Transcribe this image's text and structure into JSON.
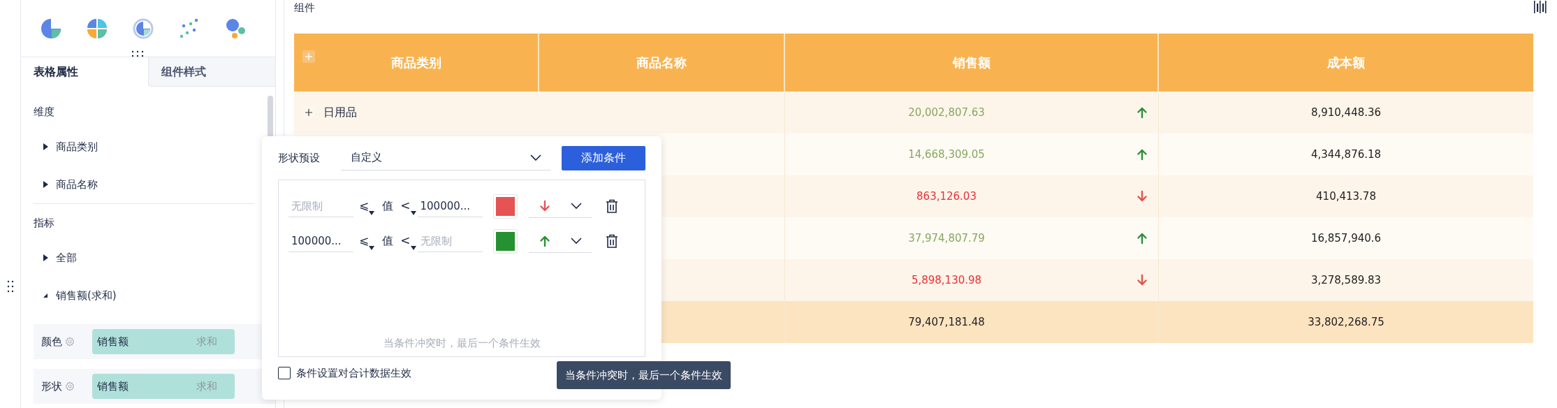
{
  "sidebar": {
    "tabs": [
      {
        "label": "表格属性",
        "selected": true
      },
      {
        "label": "组件样式",
        "selected": false
      }
    ],
    "sections": [
      {
        "title": "维度",
        "items": [
          {
            "label": "商品类别",
            "expanded": false
          },
          {
            "label": "商品名称",
            "expanded": false
          }
        ]
      },
      {
        "title": "指标",
        "items": [
          {
            "label": "全部",
            "expanded": false
          },
          {
            "label": "销售额(求和)",
            "expanded": true
          }
        ]
      }
    ],
    "properties": [
      {
        "label": "颜色",
        "field": "销售额",
        "aggregation": "求和"
      },
      {
        "label": "形状",
        "field": "销售额",
        "aggregation": "求和"
      }
    ]
  },
  "component": {
    "title": "组件"
  },
  "table": {
    "columns": [
      "商品类别",
      "商品名称",
      "销售额",
      "成本额"
    ],
    "rows": [
      {
        "kind": "data",
        "category": "日用品",
        "sales": "20,002,807.63",
        "rising": true,
        "cost": "8,910,448.36"
      },
      {
        "kind": "data",
        "sales": "14,668,309.05",
        "rising": true,
        "cost": "4,344,876.18"
      },
      {
        "kind": "data",
        "sales": "863,126.03",
        "rising": false,
        "cost": "410,413.78"
      },
      {
        "kind": "data",
        "sales": "37,974,807.79",
        "rising": true,
        "cost": "16,857,940.6"
      },
      {
        "kind": "data",
        "sales": "5,898,130.98",
        "rising": false,
        "cost": "3,278,589.83"
      },
      {
        "kind": "total",
        "sales": "79,407,181.48",
        "cost": "33,802,268.75"
      }
    ]
  },
  "shape_popup": {
    "preset_label": "形状预设",
    "preset_value": "自定义",
    "add_button": "添加条件",
    "conditions": [
      {
        "min": {
          "placeholder": "无限制"
        },
        "op_min": "⩽",
        "subject": "值",
        "op_max": "<",
        "max": {
          "value": "100000..."
        },
        "color": "#e55353",
        "arrow_up": false
      },
      {
        "min": {
          "value": "100000..."
        },
        "op_min": "⩽",
        "subject": "值",
        "op_max": "<",
        "max": {
          "placeholder": "无限制"
        },
        "color": "#259130",
        "arrow_up": true
      }
    ],
    "hint": "当条件冲突时，最后一个条件生效",
    "apply_to_total": {
      "label": "条件设置对合计数据生效",
      "checked": false
    }
  },
  "tooltip": {
    "text": "当条件冲突时，最后一个条件生效"
  }
}
